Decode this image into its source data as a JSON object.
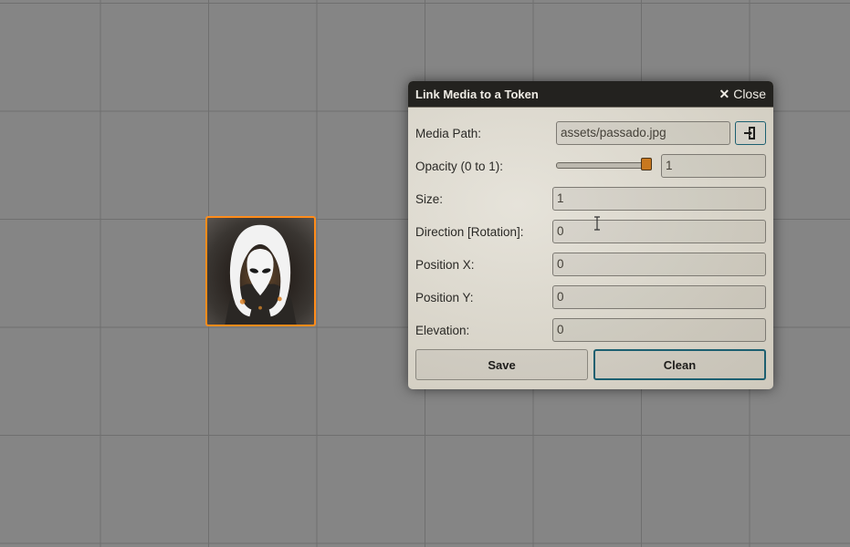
{
  "dialog": {
    "title": "Link Media to a Token",
    "close_label": "Close",
    "close_icon": "close-x-icon",
    "fields": {
      "media_path": {
        "label": "Media Path:",
        "value": "assets/passado.jpg"
      },
      "opacity": {
        "label": "Opacity (0 to 1):",
        "value": "1",
        "slider_level": 1
      },
      "size": {
        "label": "Size:",
        "value": "1"
      },
      "direction": {
        "label": "Direction [Rotation]:",
        "value": "0"
      },
      "position_x": {
        "label": "Position X:",
        "value": "0"
      },
      "position_y": {
        "label": "Position Y:",
        "value": "0"
      },
      "elevation": {
        "label": "Elevation:",
        "value": "0"
      }
    },
    "browse_icon": "file-import-icon",
    "save_label": "Save",
    "clean_label": "Clean"
  },
  "token": {
    "icon": "hooded-figure-icon",
    "border_color": "#ff8c1a"
  },
  "colors": {
    "accent": "#1c5f70",
    "header": "#23221f",
    "slider_thumb": "#c8781f"
  }
}
